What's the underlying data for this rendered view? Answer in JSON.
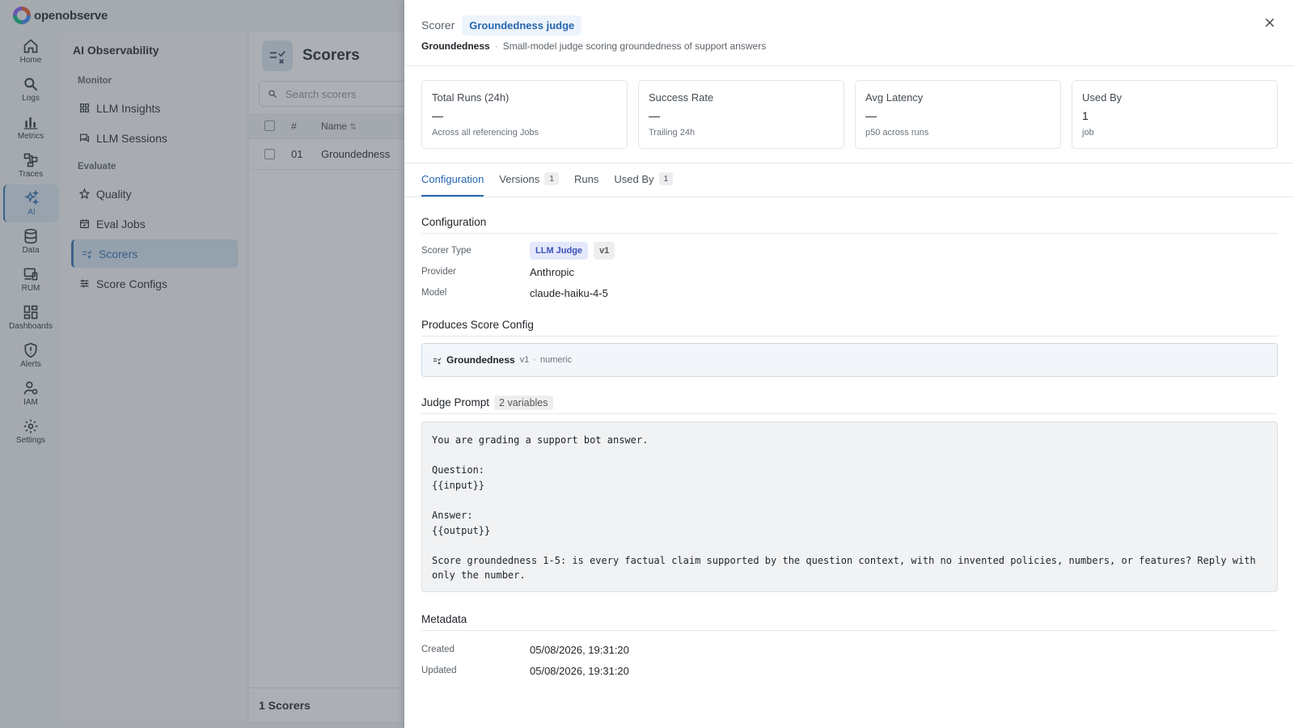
{
  "brand": {
    "name": "openobserve"
  },
  "rail": [
    {
      "label": "Home",
      "icon": "home-icon"
    },
    {
      "label": "Logs",
      "icon": "search-icon"
    },
    {
      "label": "Metrics",
      "icon": "bar-chart-icon"
    },
    {
      "label": "Traces",
      "icon": "traces-icon"
    },
    {
      "label": "AI",
      "icon": "sparkle-icon",
      "active": true
    },
    {
      "label": "Data",
      "icon": "database-icon"
    },
    {
      "label": "RUM",
      "icon": "devices-icon"
    },
    {
      "label": "Dashboards",
      "icon": "dashboard-icon"
    },
    {
      "label": "Alerts",
      "icon": "shield-alert-icon"
    },
    {
      "label": "IAM",
      "icon": "users-icon"
    },
    {
      "label": "Settings",
      "icon": "gear-icon"
    }
  ],
  "nav": {
    "title": "AI Observability",
    "sections": {
      "monitor": "Monitor",
      "evaluate": "Evaluate"
    },
    "items": {
      "llm_insights": "LLM Insights",
      "llm_sessions": "LLM Sessions",
      "quality": "Quality",
      "eval_jobs": "Eval Jobs",
      "scorers": "Scorers",
      "score_configs": "Score Configs"
    }
  },
  "page": {
    "title": "Scorers",
    "search_placeholder": "Search scorers",
    "columns": {
      "num": "#",
      "name": "Name"
    },
    "rows": [
      {
        "num": "01",
        "name": "Groundedness"
      }
    ],
    "footer": "1 Scorers"
  },
  "drawer": {
    "kicker": "Scorer",
    "name": "Groundedness judge",
    "subtitle_strong": "Groundedness",
    "subtitle_sep": "·",
    "subtitle_desc": "Small-model judge scoring groundedness of support answers",
    "stats": [
      {
        "label": "Total Runs (24h)",
        "value": "—",
        "sub": "Across all referencing Jobs"
      },
      {
        "label": "Success Rate",
        "value": "—",
        "sub": "Trailing 24h"
      },
      {
        "label": "Avg Latency",
        "value": "—",
        "sub": "p50 across runs"
      },
      {
        "label": "Used By",
        "value": "1",
        "sub": "job"
      }
    ],
    "tabs": [
      {
        "label": "Configuration",
        "count": null,
        "active": true
      },
      {
        "label": "Versions",
        "count": "1"
      },
      {
        "label": "Runs",
        "count": null
      },
      {
        "label": "Used By",
        "count": "1"
      }
    ],
    "configuration": {
      "title": "Configuration",
      "scorer_type_label": "Scorer Type",
      "scorer_type": "LLM Judge",
      "scorer_version": "v1",
      "provider_label": "Provider",
      "provider": "Anthropic",
      "model_label": "Model",
      "model": "claude-haiku-4-5"
    },
    "score_config": {
      "title": "Produces Score Config",
      "name": "Groundedness",
      "version": "v1",
      "sep": "·",
      "kind": "numeric"
    },
    "prompt": {
      "title": "Judge Prompt",
      "variables": "2 variables",
      "text": "You are grading a support bot answer.\n\nQuestion:\n{{input}}\n\nAnswer:\n{{output}}\n\nScore groundedness 1-5: is every factual claim supported by the question context, with no invented policies, numbers, or features? Reply with only the number."
    },
    "metadata": {
      "title": "Metadata",
      "created_label": "Created",
      "created": "05/08/2026, 19:31:20",
      "updated_label": "Updated",
      "updated": "05/08/2026, 19:31:20"
    }
  },
  "colors": {
    "accent": "#2566b0",
    "scrim": "#46505c"
  }
}
